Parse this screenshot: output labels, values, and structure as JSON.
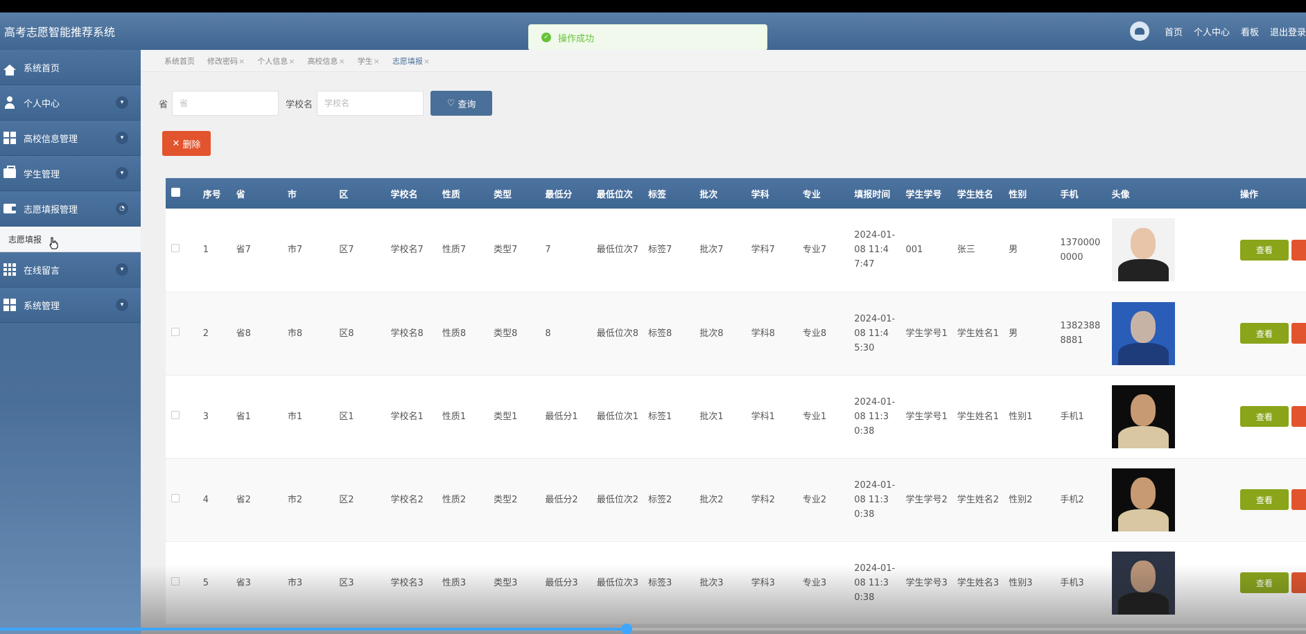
{
  "header": {
    "app_title": "高考志愿智能推荐系统",
    "links": [
      "首页",
      "个人中心",
      "看板",
      "退出登录"
    ]
  },
  "toast": {
    "message": "操作成功",
    "icon": "check-icon"
  },
  "sidebar": {
    "items": [
      {
        "label": "系统首页",
        "icon": "home-icon"
      },
      {
        "label": "个人中心",
        "icon": "user-icon"
      },
      {
        "label": "高校信息管理",
        "icon": "grid-icon"
      },
      {
        "label": "学生管理",
        "icon": "briefcase-icon"
      },
      {
        "label": "志愿填报管理",
        "icon": "wallet-icon"
      },
      {
        "label": "在线留言",
        "icon": "grid9-icon"
      },
      {
        "label": "系统管理",
        "icon": "grid-icon"
      }
    ],
    "sub_item": "志愿填报"
  },
  "tabs": [
    {
      "label": "系统首页",
      "closable": false
    },
    {
      "label": "修改密码",
      "closable": true
    },
    {
      "label": "个人信息",
      "closable": true
    },
    {
      "label": "高校信息",
      "closable": true
    },
    {
      "label": "学生",
      "closable": true
    },
    {
      "label": "志愿填报",
      "closable": true
    }
  ],
  "search": {
    "province_label": "省",
    "province_placeholder": "省",
    "school_label": "学校名",
    "school_placeholder": "学校名",
    "button": "查询"
  },
  "delete_button": "删除",
  "table": {
    "headers": [
      "序号",
      "省",
      "市",
      "区",
      "学校名",
      "性质",
      "类型",
      "最低分",
      "最低位次",
      "标签",
      "批次",
      "学科",
      "专业",
      "填报时间",
      "学生学号",
      "学生姓名",
      "性别",
      "手机",
      "头像",
      "操作"
    ],
    "view_button": "查看",
    "rows": [
      [
        "1",
        "省7",
        "市7",
        "区7",
        "学校名7",
        "性质7",
        "类型7",
        "7",
        "最低位次7",
        "标签7",
        "批次7",
        "学科7",
        "专业7",
        "2024-01-08 11:47:47",
        "001",
        "张三",
        "男",
        "13700000000"
      ],
      [
        "2",
        "省8",
        "市8",
        "区8",
        "学校名8",
        "性质8",
        "类型8",
        "8",
        "最低位次8",
        "标签8",
        "批次8",
        "学科8",
        "专业8",
        "2024-01-08 11:45:30",
        "学生学号1",
        "学生姓名1",
        "男",
        "13823888881"
      ],
      [
        "3",
        "省1",
        "市1",
        "区1",
        "学校名1",
        "性质1",
        "类型1",
        "最低分1",
        "最低位次1",
        "标签1",
        "批次1",
        "学科1",
        "专业1",
        "2024-01-08 11:30:38",
        "学生学号1",
        "学生姓名1",
        "性别1",
        "手机1"
      ],
      [
        "4",
        "省2",
        "市2",
        "区2",
        "学校名2",
        "性质2",
        "类型2",
        "最低分2",
        "最低位次2",
        "标签2",
        "批次2",
        "学科2",
        "专业2",
        "2024-01-08 11:30:38",
        "学生学号2",
        "学生姓名2",
        "性别2",
        "手机2"
      ],
      [
        "5",
        "省3",
        "市3",
        "区3",
        "学校名3",
        "性质3",
        "类型3",
        "最低分3",
        "最低位次3",
        "标签3",
        "批次3",
        "学科3",
        "专业3",
        "2024-01-08 11:30:38",
        "学生学号3",
        "学生姓名3",
        "性别3",
        "手机3"
      ]
    ],
    "photo_colors": [
      {
        "bg": "#f2f2f2",
        "face": "#e8c4a8",
        "body": "#222222"
      },
      {
        "bg": "#2a5db8",
        "face": "#c7b3a6",
        "body": "#1e3c7a"
      },
      {
        "bg": "#0c0c0c",
        "face": "#c79a74",
        "body": "#d8c7a2"
      },
      {
        "bg": "#0c0c0c",
        "face": "#c79a74",
        "body": "#d8c7a2"
      },
      {
        "bg": "#2b3344",
        "face": "#b89378",
        "body": "#1a1a1a"
      }
    ]
  },
  "video_progress": 0.48,
  "colors": {
    "header": "#4a6f98",
    "accent_green": "#8aa51a",
    "accent_red": "#e2542d",
    "toast_green": "#67c23a"
  }
}
